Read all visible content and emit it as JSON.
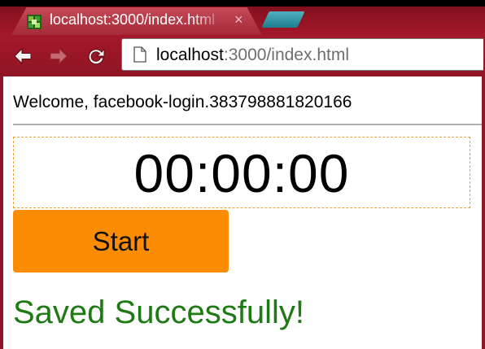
{
  "browser": {
    "tab": {
      "title": "localhost:3000/index.html",
      "close_glyph": "×",
      "favicon": "app-favicon-icon"
    },
    "new_tab": "new-tab-icon",
    "toolbar": {
      "back": "back-arrow-icon",
      "forward": "forward-arrow-icon",
      "reload": "reload-icon"
    },
    "address": {
      "host": "localhost",
      "rest": ":3000/index.html",
      "page_icon": "page-icon"
    },
    "colors": {
      "frame": "#a3182a",
      "new_tab": "#2a8c9b"
    }
  },
  "page": {
    "welcome": "Welcome, facebook-login.383798881820166",
    "timer": "00:00:00",
    "start_label": "Start",
    "status": "Saved Successfully!",
    "colors": {
      "start_button": "#fb8c04",
      "status_text": "#1f7a16",
      "timer_border": "#e8a23c"
    }
  }
}
